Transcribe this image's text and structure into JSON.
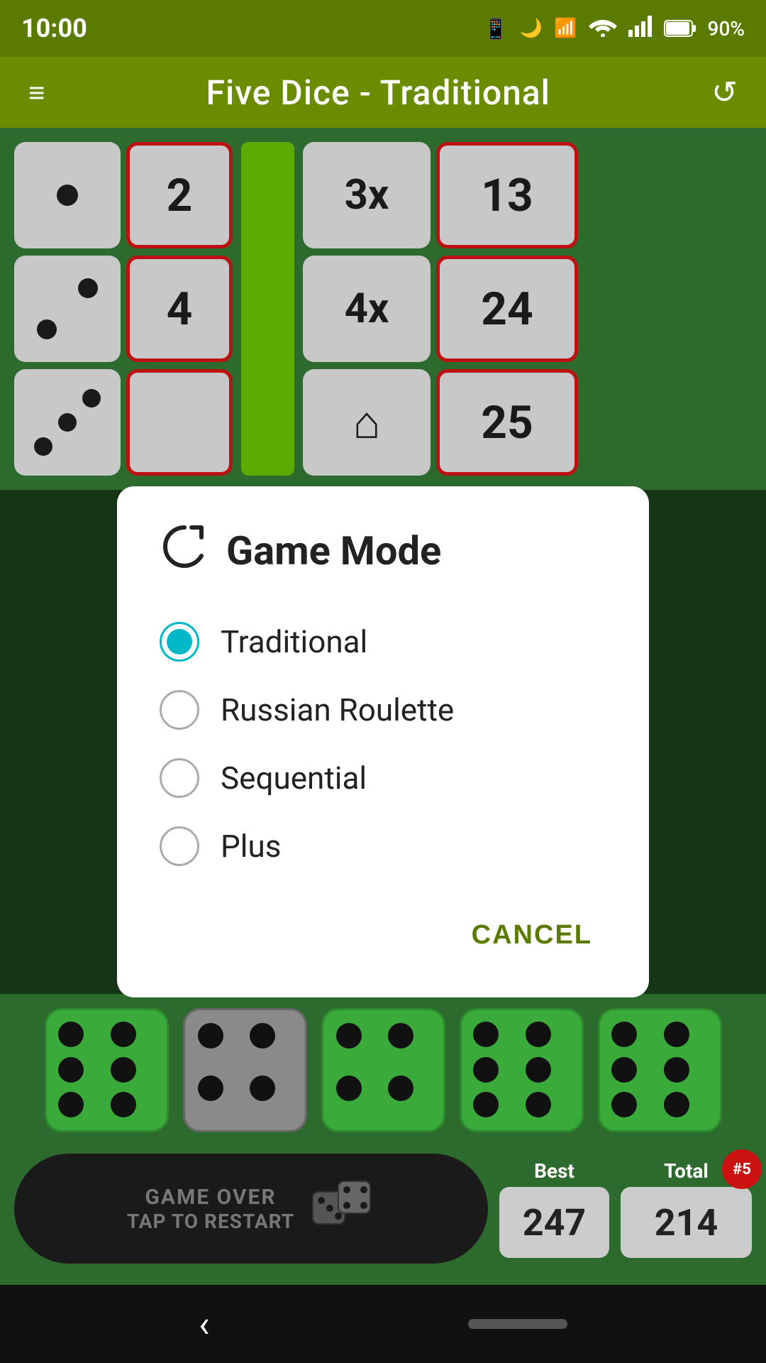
{
  "statusBar": {
    "time": "10:00",
    "battery": "90%",
    "wifiIcon": "wifi",
    "signalIcon": "signal",
    "batteryIcon": "battery"
  },
  "header": {
    "title": "Five Dice - Traditional",
    "menuIcon": "≡",
    "refreshIcon": "↺"
  },
  "gameBoard": {
    "cells": [
      {
        "type": "dice",
        "value": "•",
        "redBorder": false
      },
      {
        "type": "value",
        "value": "2",
        "redBorder": true
      },
      {
        "type": "multiplier",
        "value": "3x",
        "redBorder": false
      },
      {
        "type": "score",
        "value": "13",
        "redBorder": true
      },
      {
        "type": "dice2",
        "value": "••",
        "redBorder": false
      },
      {
        "type": "value2",
        "value": "4",
        "redBorder": true
      },
      {
        "type": "multiplier2",
        "value": "4x",
        "redBorder": false
      },
      {
        "type": "score2",
        "value": "24",
        "redBorder": true
      },
      {
        "type": "dice3",
        "value": "•••",
        "redBorder": false
      },
      {
        "type": "value3",
        "value": "",
        "redBorder": true
      },
      {
        "type": "home",
        "value": "⌂",
        "redBorder": false
      },
      {
        "type": "score3",
        "value": "25",
        "redBorder": true
      }
    ]
  },
  "dialog": {
    "title": "Game Mode",
    "icon": "refresh",
    "options": [
      {
        "id": "traditional",
        "label": "Traditional",
        "selected": true
      },
      {
        "id": "russian-roulette",
        "label": "Russian Roulette",
        "selected": false
      },
      {
        "id": "sequential",
        "label": "Sequential",
        "selected": false
      },
      {
        "id": "plus",
        "label": "Plus",
        "selected": false
      }
    ],
    "cancelLabel": "CANCEL"
  },
  "bottomDice": {
    "dice": [
      {
        "type": "green",
        "pips": 6
      },
      {
        "type": "gray",
        "pips": 4
      },
      {
        "type": "green",
        "pips": 4
      },
      {
        "type": "green",
        "pips": 6
      },
      {
        "type": "green",
        "pips": 6
      }
    ]
  },
  "scoreBar": {
    "gameOverLine1": "GAME OVER",
    "gameOverLine2": "TAP TO RESTART",
    "bestLabel": "Best",
    "bestValue": "247",
    "totalLabel": "Total",
    "totalValue": "214",
    "badge": "#5"
  },
  "navBar": {
    "backIcon": "‹"
  }
}
